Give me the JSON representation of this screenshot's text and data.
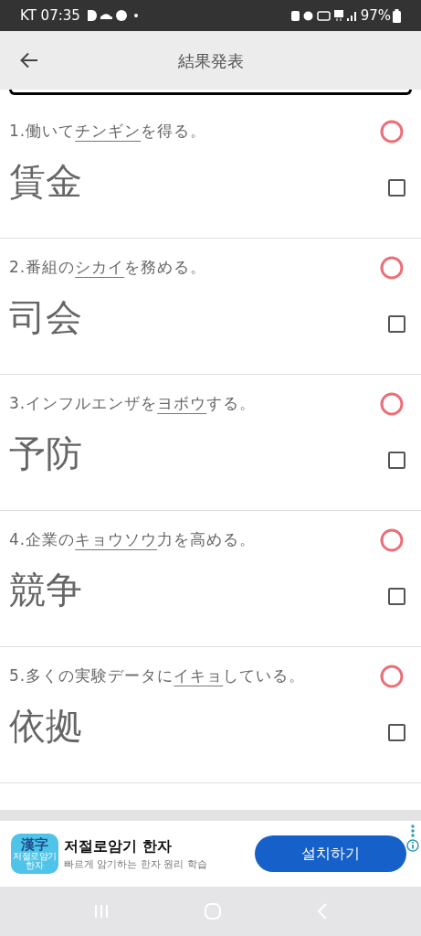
{
  "status_bar": {
    "carrier_time": "KT 07:35",
    "battery": "97%"
  },
  "header": {
    "title": "結果発表"
  },
  "questions": [
    {
      "number": "1.",
      "before": "働いて",
      "underlined": "チンギン",
      "after": "を得る。",
      "answer": "賃金",
      "correct": true,
      "checked": false
    },
    {
      "number": "2.",
      "before": "番組の",
      "underlined": "シカイ",
      "after": "を務める。",
      "answer": "司会",
      "correct": true,
      "checked": false
    },
    {
      "number": "3.",
      "before": "インフルエンザを",
      "underlined": "ヨボウ",
      "after": "する。",
      "answer": "予防",
      "correct": true,
      "checked": false
    },
    {
      "number": "4.",
      "before": "企業の",
      "underlined": "キョウソウ",
      "after": "力を高める。",
      "answer": "競争",
      "correct": true,
      "checked": false
    },
    {
      "number": "5.",
      "before": "多くの実験データに",
      "underlined": "イキョ",
      "after": "している。",
      "answer": "依拠",
      "correct": true,
      "checked": false
    }
  ],
  "ad": {
    "icon_main": "漢字",
    "icon_sub": "저절로암기",
    "icon_sub2": "한자",
    "title": "저절로암기 한자",
    "subtitle": "빠르게 암기하는 한자 원리 학습",
    "button": "설치하기"
  }
}
